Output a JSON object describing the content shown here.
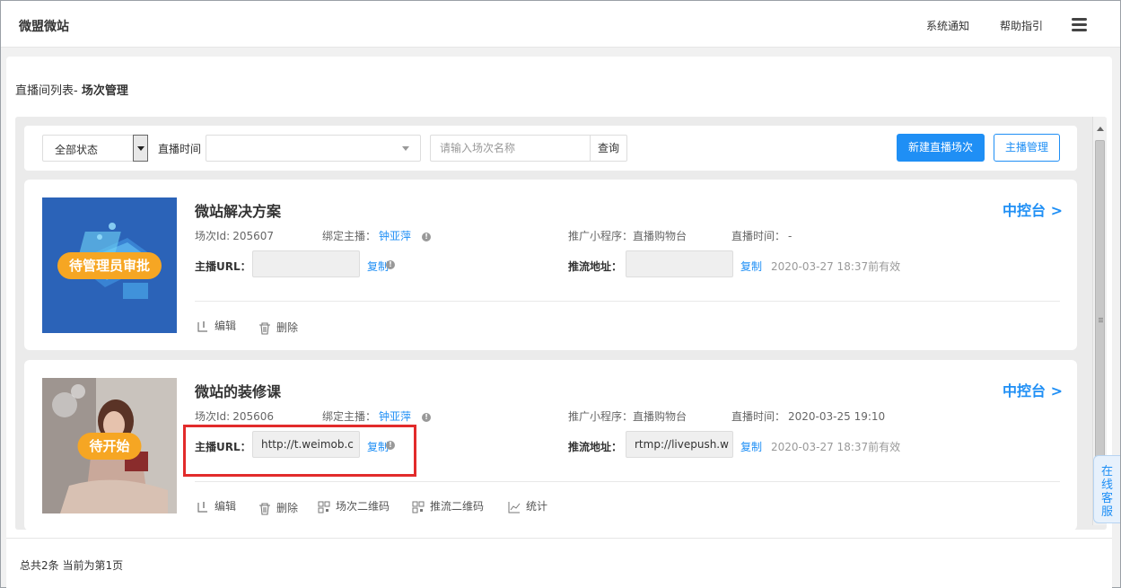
{
  "topbar": {
    "brand": "微盟微站",
    "notifications": "系统通知",
    "help": "帮助指引"
  },
  "breadcrumb": {
    "prefix": "直播间列表- ",
    "current": "场次管理"
  },
  "filters": {
    "status_value": "全部状态",
    "time_label": "直播时间",
    "search_placeholder": "请输入场次名称",
    "search_button": "查询",
    "new_button": "新建直播场次",
    "host_manage_button": "主播管理"
  },
  "labels": {
    "session_id": "场次Id:",
    "bind_host": "绑定主播：",
    "mini_program": "推广小程序：",
    "live_time": "直播时间：",
    "host_url": "主播URL：",
    "push_url": "推流地址：",
    "copy": "复制",
    "control": "中控台 >"
  },
  "actions": {
    "edit": "编辑",
    "delete": "删除",
    "session_qr": "场次二维码",
    "push_qr": "推流二维码",
    "stats": "统计"
  },
  "sessions": [
    {
      "title": "微站解决方案",
      "badge": "待管理员审批",
      "id": "205607",
      "host": "钟亚萍",
      "mini_program": "直播购物台",
      "live_time": "-",
      "host_url": "",
      "push_url": "",
      "valid_until": "2020-03-27 18:37前有效"
    },
    {
      "title": "微站的装修课",
      "badge": "待开始",
      "id": "205606",
      "host": "钟亚萍",
      "mini_program": "直播购物台",
      "live_time": "2020-03-25 19:10",
      "host_url": "http://t.weimob.c",
      "push_url": "rtmp://livepush.w",
      "valid_until": "2020-03-27 18:37前有效"
    }
  ],
  "pager": {
    "text": "总共2条 当前为第1页"
  },
  "service": {
    "chars": [
      "在",
      "线",
      "客",
      "服"
    ]
  },
  "colors": {
    "accent": "#1f8ff5",
    "badge": "#f6a623",
    "highlight": "#e22b2b"
  }
}
